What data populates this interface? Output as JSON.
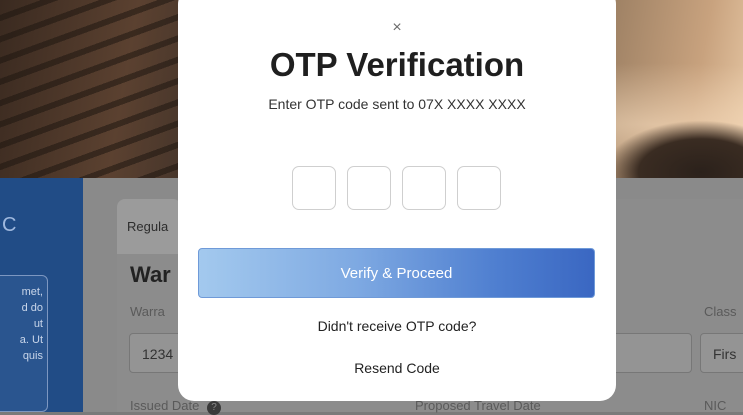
{
  "background": {
    "sidebar_mark": "C",
    "sidebar_card_lines": [
      "met,",
      "d do",
      "ut",
      "a. Ut",
      "quis"
    ],
    "tab_label": "Regula",
    "section_title": "War",
    "warrant_label": "Warra",
    "class_label": "Class",
    "warrant_value": "1234",
    "class_value": "Firs",
    "issued_label": "Issued Date",
    "issued_help_icon": "question-circle-icon",
    "proposed_label": "Proposed Travel Date",
    "nic_label": "NIC"
  },
  "modal": {
    "close_glyph": "×",
    "title": "OTP Verification",
    "subtitle": "Enter OTP code sent to 07X XXXX XXXX",
    "otp_digits": [
      "",
      "",
      "",
      ""
    ],
    "verify_label": "Verify & Proceed",
    "didnt_receive": "Didn't receive OTP code?",
    "resend_label": "Resend Code"
  },
  "colors": {
    "sidebar_bg": "#214c86",
    "verify_gradient_start": "#a3c9ee",
    "verify_gradient_end": "#3a67c2",
    "modal_bg": "#ffffff"
  }
}
